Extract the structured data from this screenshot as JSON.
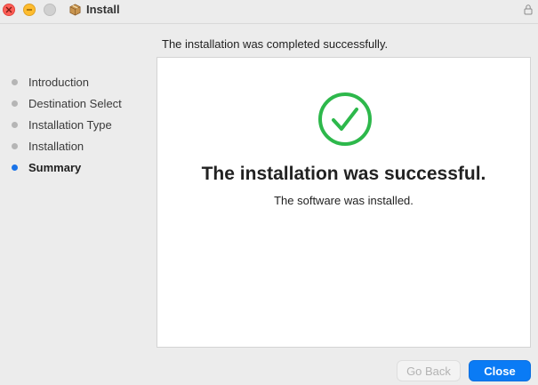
{
  "window": {
    "title": "Install",
    "icons": {
      "close": "close-icon",
      "minimize": "minimize-icon",
      "zoom": "zoom-icon",
      "app": "package-icon",
      "lock": "lock-icon"
    }
  },
  "header": {
    "message": "The installation was completed successfully."
  },
  "sidebar": {
    "steps": [
      {
        "label": "Introduction",
        "state": "done"
      },
      {
        "label": "Destination Select",
        "state": "done"
      },
      {
        "label": "Installation Type",
        "state": "done"
      },
      {
        "label": "Installation",
        "state": "done"
      },
      {
        "label": "Summary",
        "state": "current"
      }
    ]
  },
  "main": {
    "status_icon": "check-circle-icon",
    "title": "The installation was successful.",
    "subtitle": "The software was installed."
  },
  "buttons": {
    "back_label": "Go Back",
    "back_enabled": false,
    "close_label": "Close"
  },
  "colors": {
    "accent": "#0a7bf5",
    "success": "#2db84b",
    "active_dot": "#1a73e8",
    "inactive_dot": "#b5b5b5"
  }
}
